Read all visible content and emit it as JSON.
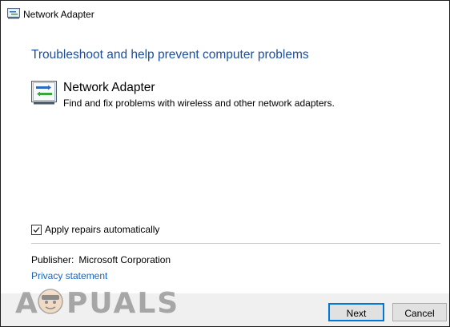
{
  "window": {
    "title": "Network Adapter",
    "icon": "network-adapter-icon"
  },
  "main": {
    "heading": "Troubleshoot and help prevent computer problems",
    "item": {
      "icon": "network-adapter-icon",
      "title": "Network Adapter",
      "description": "Find and fix problems with wireless and other network adapters."
    },
    "apply_repairs": {
      "label": "Apply repairs automatically",
      "checked": true
    },
    "publisher": {
      "label": "Publisher:",
      "value": "Microsoft Corporation"
    },
    "privacy_link": "Privacy statement"
  },
  "buttons": {
    "next": "Next",
    "cancel": "Cancel"
  },
  "watermark": {
    "text": "APPUALS"
  },
  "colors": {
    "heading": "#1c4e9c",
    "link": "#1565c0",
    "footer_bg": "#f0f0f0",
    "button_focus_border": "#0078d7"
  }
}
